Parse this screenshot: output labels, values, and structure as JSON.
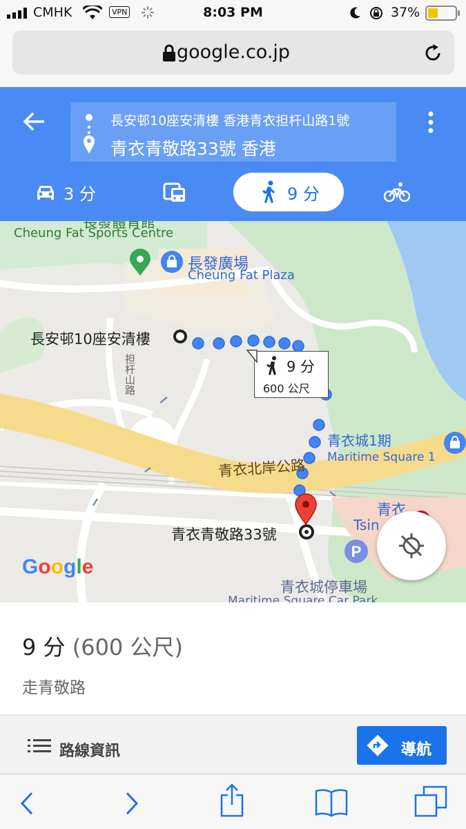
{
  "status_bar": {
    "carrier": "CMHK",
    "vpn": "VPN",
    "time": "8:03 PM",
    "battery": "37%",
    "battery_level": 0.37
  },
  "browser": {
    "url": "google.co.jp"
  },
  "directions": {
    "from": "長安邨10座安清樓 香港青衣担杆山路1號",
    "to": "青衣青敬路33號 香港",
    "modes": [
      {
        "name": "car",
        "icon": "car-icon",
        "label": "3 分"
      },
      {
        "name": "transit",
        "icon": "bus-icon",
        "label": ""
      },
      {
        "name": "walk",
        "icon": "walk-icon",
        "label": "9 分"
      },
      {
        "name": "bike",
        "icon": "bike-icon",
        "label": ""
      }
    ]
  },
  "map": {
    "labels": {
      "sports_centre_cn": "長發體育館",
      "sports_centre_en": "Cheung Fat Sports Centre",
      "plaza_cn": "長發廣場",
      "plaza_en": "Cheung Fat Plaza",
      "origin": "長安邨10座安清樓",
      "road_vertical": "担杆山路",
      "callout_time": "9 分",
      "callout_dist": "600 公尺",
      "maritime_cn": "青衣城1期",
      "maritime_en": "Maritime Square 1",
      "main_road": "青衣北岸公路",
      "destination": "青衣青敬路33號",
      "tsing_cn": "青衣",
      "tsing_en": "Tsin",
      "carpark_cn": "青衣城停車場",
      "carpark_en": "Maritime Square Car Park",
      "google": "Google"
    }
  },
  "summary": {
    "time": "9 分",
    "distance": "(600 公尺)",
    "via": "走青敬路"
  },
  "actions": {
    "route_info": "路線資訊",
    "navigate": "導航"
  },
  "colors": {
    "header_blue": "#4a8af4",
    "nav_blue": "#1a73e8",
    "route_dot": "#4285f4",
    "pin_red": "#ea4335"
  }
}
